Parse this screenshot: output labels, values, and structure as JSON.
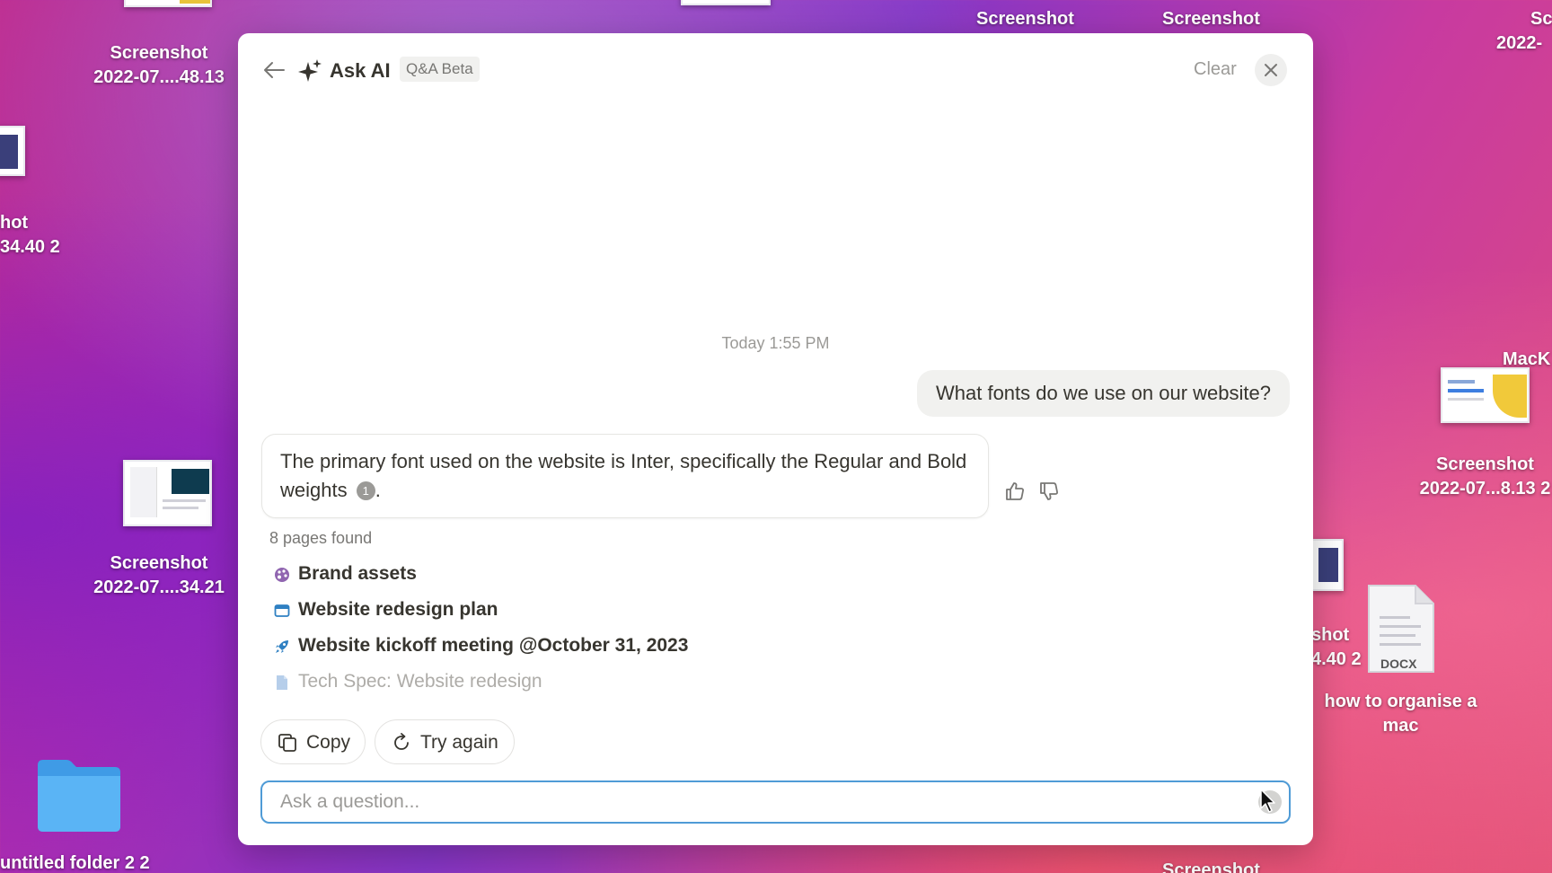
{
  "desktop": {
    "icons": [
      {
        "label_line1": "Screenshot",
        "label_line2": "2022-07....48.13"
      },
      {
        "label_line1": "hot",
        "label_line2": "34.40 2"
      },
      {
        "label_line1": "Screenshot",
        "label_line2": "2022-07....34.21"
      },
      {
        "label_line1": "untitled folder 2 2"
      },
      {
        "label_line1": "Screenshot"
      },
      {
        "label_line1": "Screenshot"
      },
      {
        "label_line1": "Sc",
        "label_line2": "2022-"
      },
      {
        "label_line1": "MacK"
      },
      {
        "label_line1": "Screenshot",
        "label_line2": "2022-07...8.13 2"
      },
      {
        "label_line1": "shot",
        "label_line2": "4.40 2"
      },
      {
        "label_line1": "how to organise a",
        "label_line2": "mac",
        "badge": "DOCX"
      },
      {
        "label_line1": "Screenshot"
      }
    ]
  },
  "modal": {
    "title": "Ask AI",
    "badge": "Q&A Beta",
    "clear_label": "Clear",
    "timestamp": "Today 1:55 PM",
    "user_message": "What fonts do we use on our website?",
    "ai_answer": "The primary font used on the website is Inter, specifically the Regular and Bold weights",
    "citation": "1",
    "answer_end": ".",
    "pages_found": "8 pages found",
    "sources": [
      {
        "label": "Brand assets",
        "icon": "palette-icon",
        "color": "#9065b0"
      },
      {
        "label": "Website redesign plan",
        "icon": "browser-window-icon",
        "color": "#2f80c2"
      },
      {
        "label": "Website kickoff meeting @October 31, 2023",
        "icon": "rocket-icon",
        "color": "#2f80c2"
      },
      {
        "label": "Tech Spec: Website redesign",
        "icon": "document-icon",
        "color": "#6f9fd6"
      }
    ],
    "copy_label": "Copy",
    "try_again_label": "Try again",
    "input_placeholder": "Ask a question...",
    "accent_color": "#4f9bd6"
  }
}
